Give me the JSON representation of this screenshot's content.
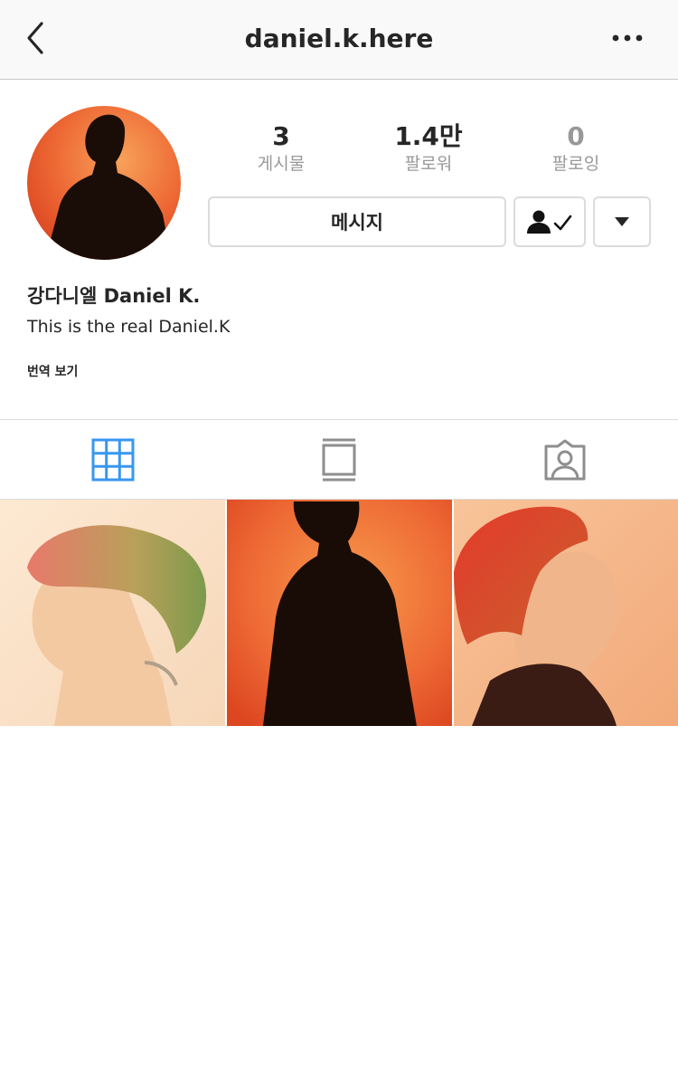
{
  "header": {
    "username": "daniel.k.here",
    "back_icon": "chevron-left-icon",
    "more_icon": "more-horizontal-icon"
  },
  "profile": {
    "stats": [
      {
        "value": "3",
        "label": "게시물"
      },
      {
        "value": "1.4만",
        "label": "팔로워"
      },
      {
        "value": "0",
        "label": "팔로잉"
      }
    ],
    "message_label": "메시지",
    "following_icon": "user-check-icon",
    "dropdown_icon": "caret-down-icon",
    "full_name": "강다니엘 Daniel K.",
    "bio": "This is the real Daniel.K",
    "translate_label": "번역 보기"
  },
  "tabs": [
    {
      "name": "grid",
      "icon": "grid-icon",
      "active": true
    },
    {
      "name": "igtv",
      "icon": "feed-icon",
      "active": false
    },
    {
      "name": "tagged",
      "icon": "tagged-user-icon",
      "active": false
    }
  ],
  "colors": {
    "active_tab": "#3897f0",
    "inactive_icon": "#8e8e8e",
    "text_primary": "#262626",
    "text_secondary": "#999999",
    "border": "#dbdbdb"
  }
}
